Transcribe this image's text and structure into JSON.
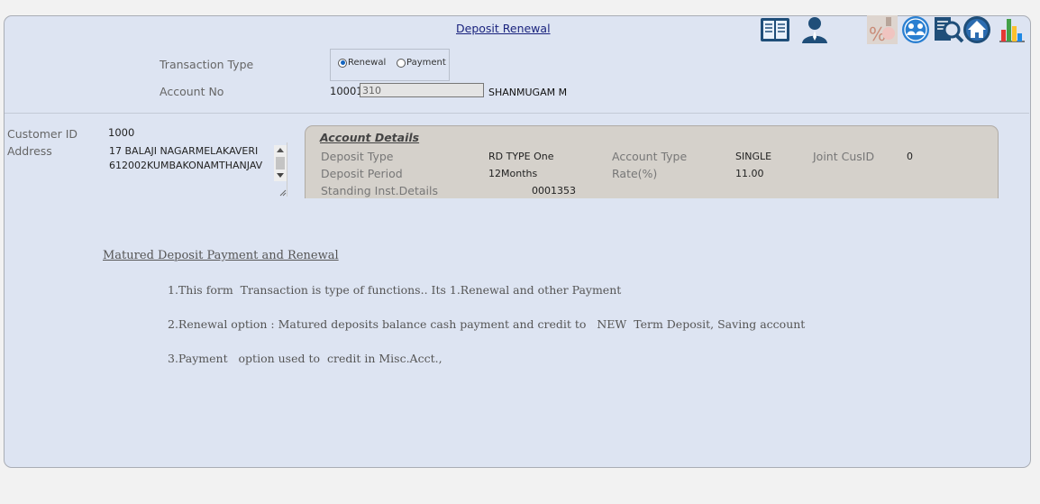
{
  "header": {
    "title": "Deposit Renewal",
    "toolbar_icons": [
      "ledger-icon",
      "user-icon",
      "interest-icon",
      "customer-group-icon",
      "search-report-icon",
      "home-icon",
      "chart-icon"
    ]
  },
  "form": {
    "transaction_type_label": "Transaction Type",
    "radio_renewal_label": "Renewal",
    "radio_payment_label": "Payment",
    "selected_transaction": "Renewal",
    "account_no_label": "Account No",
    "account_prefix": "10001",
    "account_no_value": "310",
    "customer_name": "SHANMUGAM M"
  },
  "customer": {
    "customer_id_label": "Customer ID",
    "customer_id": "1000",
    "address_label": "Address",
    "address_line1": "17 BALAJI NAGARMELAKAVERI",
    "address_line2": "612002KUMBAKONAMTHANJAV"
  },
  "account_details": {
    "title": "Account Details",
    "deposit_type_label": "Deposit Type",
    "deposit_type": "RD TYPE One",
    "account_type_label": "Account Type",
    "account_type": "SINGLE",
    "joint_cusid_label": "Joint CusID",
    "joint_cusid": "0",
    "deposit_period_label": "Deposit Period",
    "deposit_period": "12Months",
    "rate_label": "Rate(%)",
    "rate": "11.00",
    "standing_inst_label": "Standing Inst.Details",
    "standing_inst": "0001353"
  },
  "notes": {
    "title": "Matured Deposit Payment and Renewal",
    "line1": "1.This form  Transaction is type of functions.. Its 1.Renewal and other Payment",
    "line2": "2.Renewal option : Matured deposits balance cash payment and credit to   NEW  Term Deposit, Saving account",
    "line3": "3.Payment   option used to  credit in Misc.Acct.,"
  },
  "colors": {
    "panel_bg": "#dde4f2",
    "details_bg": "#d5d1cb",
    "title_link": "#1a237e"
  }
}
